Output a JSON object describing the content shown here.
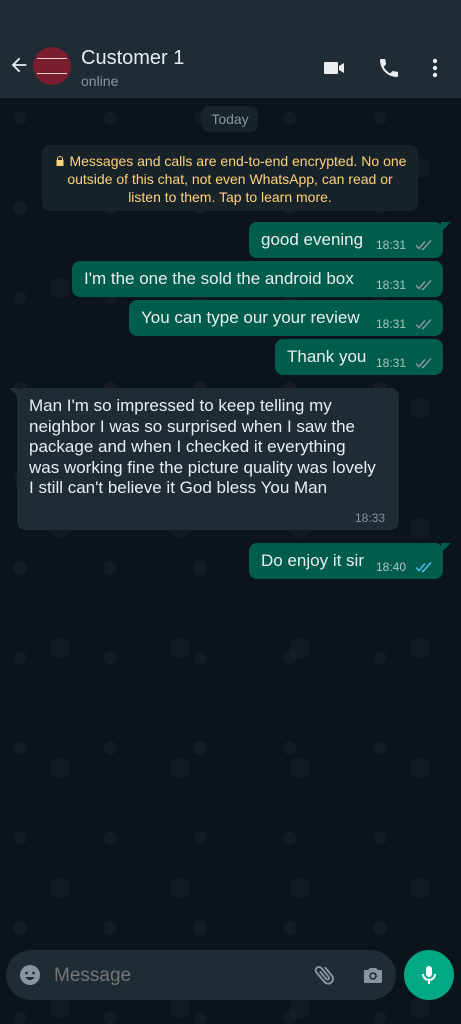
{
  "header": {
    "contact_name": "Customer 1",
    "status": "online",
    "avatar_text": "THERE'S POWER IN THE PLACE OF WISDOM"
  },
  "chat": {
    "date_label": "Today",
    "encryption_notice": "Messages and calls are end-to-end encrypted. No one outside of this chat, not even WhatsApp, can read or listen to them. Tap to learn more.",
    "messages": [
      {
        "direction": "out",
        "text": "good evening",
        "time": "18:31",
        "status": "read"
      },
      {
        "direction": "out",
        "text": "I'm the one the sold the android box",
        "time": "18:31",
        "status": "read"
      },
      {
        "direction": "out",
        "text": "You can type our your review",
        "time": "18:31",
        "status": "read"
      },
      {
        "direction": "out",
        "text": "Thank you",
        "time": "18:31",
        "status": "read"
      },
      {
        "direction": "in",
        "text": "Man I'm so impressed to keep telling my neighbor I was so surprised when I saw the package and when I checked it everything was working fine the picture quality was lovely I still can't believe it God bless You Man",
        "time": "18:33"
      },
      {
        "direction": "out",
        "text": "Do enjoy it sir",
        "time": "18:40",
        "status": "read"
      }
    ]
  },
  "composer": {
    "placeholder": "Message"
  },
  "colors": {
    "header_bg": "#1f2c34",
    "outgoing_bubble": "#005c4b",
    "incoming_bubble": "#1f2c34",
    "accent": "#00a884",
    "read_ticks": "#53bdeb",
    "encryption_text": "#ffd279"
  },
  "icons": [
    "back-arrow-icon",
    "video-call-icon",
    "phone-icon",
    "more-options-icon",
    "emoji-icon",
    "attach-icon",
    "camera-icon",
    "mic-icon",
    "lock-icon",
    "double-tick-icon"
  ]
}
